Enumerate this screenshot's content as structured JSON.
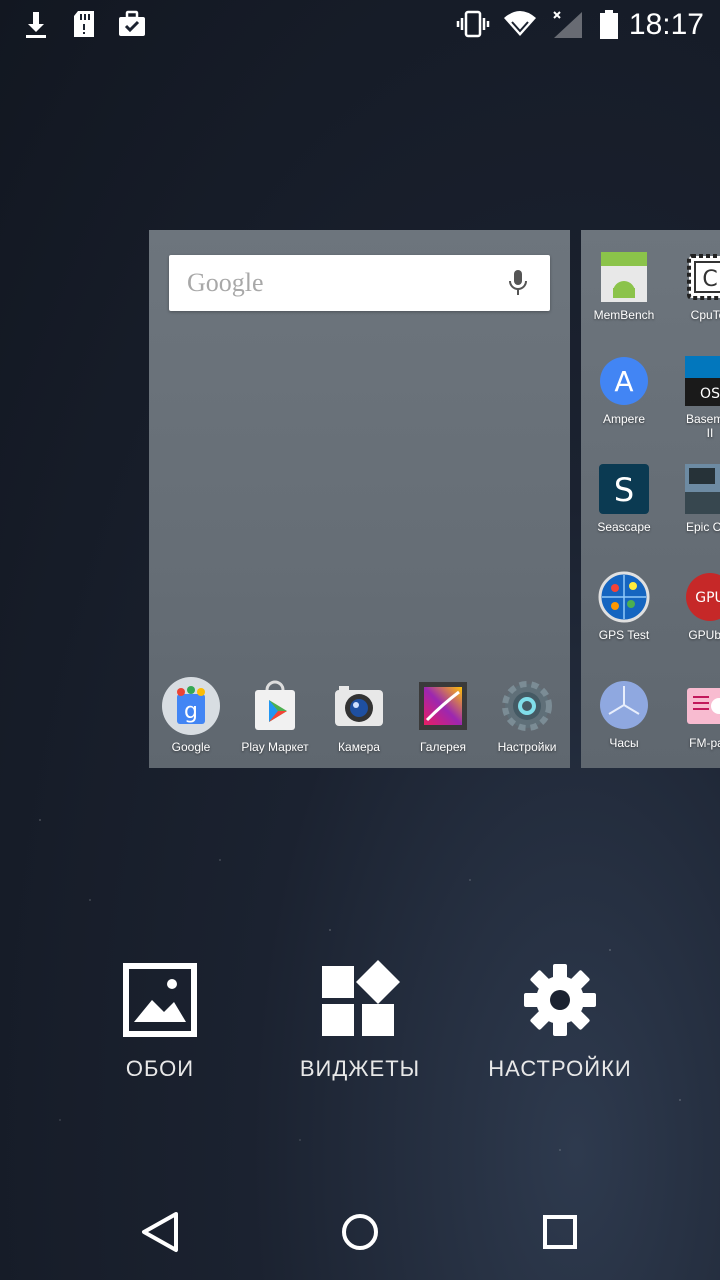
{
  "status_bar": {
    "time": "18:17",
    "left_icons": [
      "download-icon",
      "sd-card-icon",
      "briefcase-check-icon"
    ],
    "right_icons": [
      "vibrate-icon",
      "wifi-icon",
      "signal-icon",
      "battery-icon"
    ]
  },
  "home": {
    "search": {
      "placeholder": "Google"
    },
    "dock": [
      {
        "label": "Google",
        "icon": "google-folder-icon"
      },
      {
        "label": "Play Маркет",
        "icon": "play-store-icon"
      },
      {
        "label": "Камера",
        "icon": "camera-icon"
      },
      {
        "label": "Галерея",
        "icon": "gallery-icon"
      },
      {
        "label": "Настройки",
        "icon": "settings-icon"
      }
    ]
  },
  "right_page": {
    "apps": [
      {
        "label": "MemBench",
        "icon": "membench-icon"
      },
      {
        "label": "CpuTer",
        "icon": "cputemp-icon"
      },
      {
        "label": "Ampere",
        "icon": "ampere-icon"
      },
      {
        "label": "Basemar\nII",
        "icon": "basemark-icon"
      },
      {
        "label": "Seascape",
        "icon": "seascape-icon"
      },
      {
        "label": "Epic Cita",
        "icon": "epic-citadel-icon"
      },
      {
        "label": "GPS Test",
        "icon": "gps-test-icon"
      },
      {
        "label": "GPUber",
        "icon": "gpubench-icon"
      },
      {
        "label": "Часы",
        "icon": "clock-icon"
      },
      {
        "label": "FM-рад",
        "icon": "fm-radio-icon"
      }
    ]
  },
  "options": {
    "wallpapers": "ОБОИ",
    "widgets": "ВИДЖЕТЫ",
    "settings": "НАСТРОЙКИ"
  },
  "colors": {
    "accent": "#ffffff",
    "page_bg": "#6b737b"
  }
}
